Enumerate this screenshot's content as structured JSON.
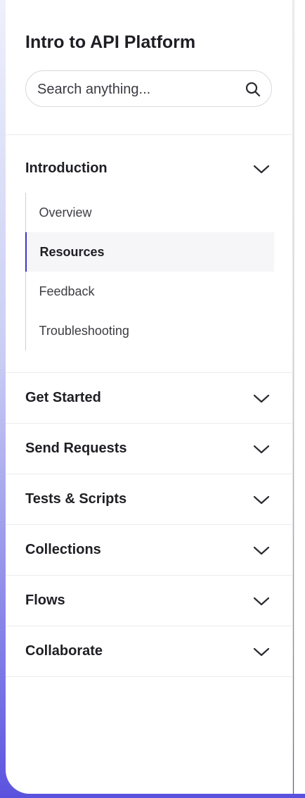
{
  "sidebar": {
    "title": "Intro to API Platform",
    "search": {
      "placeholder": "Search anything...",
      "icon": "search-icon"
    },
    "sections": [
      {
        "label": "Introduction",
        "expanded": true,
        "items": [
          {
            "label": "Overview",
            "active": false
          },
          {
            "label": "Resources",
            "active": true
          },
          {
            "label": "Feedback",
            "active": false
          },
          {
            "label": "Troubleshooting",
            "active": false
          }
        ]
      },
      {
        "label": "Get Started",
        "expanded": false
      },
      {
        "label": "Send Requests",
        "expanded": false
      },
      {
        "label": "Tests & Scripts",
        "expanded": false
      },
      {
        "label": "Collections",
        "expanded": false
      },
      {
        "label": "Flows",
        "expanded": false
      },
      {
        "label": "Collaborate",
        "expanded": false
      }
    ]
  },
  "colors": {
    "accent": "#3a36c8",
    "active_bg": "#f6f6f8",
    "text_primary": "#1e1e24",
    "text_secondary": "#3c3c44",
    "divider": "#ececef",
    "background_gradient_end": "#5b53de"
  }
}
